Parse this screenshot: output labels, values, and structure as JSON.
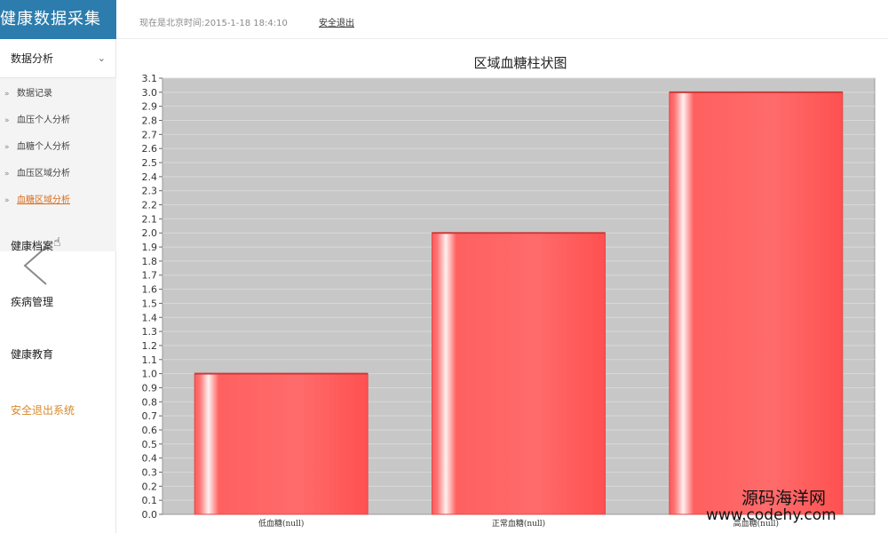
{
  "brand": {
    "title": "健康数据采集"
  },
  "topbar": {
    "time_text": "现在是北京时间:2015-1-18 18:4:10",
    "logout_label": "安全退出"
  },
  "sidebar": {
    "analysis_label": "数据分析",
    "sub_items": [
      {
        "label": "数据记录"
      },
      {
        "label": "血压个人分析"
      },
      {
        "label": "血糖个人分析"
      },
      {
        "label": "血压区域分析"
      },
      {
        "label": "血糖区域分析"
      }
    ],
    "archive_label": "健康档案",
    "disease_label": "疾病管理",
    "education_label": "健康教育",
    "logout_system_label": "安全退出系统"
  },
  "watermark": {
    "line1": "源码海洋网",
    "line2": "www.codehy.com"
  },
  "chart_data": {
    "type": "bar",
    "title": "区域血糖柱状图",
    "categories": [
      "低血糖(null)",
      "正常血糖(null)",
      "高血糖(null)"
    ],
    "values": [
      1.0,
      2.0,
      3.0
    ],
    "ylim": [
      0,
      3.1
    ],
    "ytick_step": 0.1,
    "grid": true,
    "colors": {
      "bar": "#ff5a5a",
      "bar_highlight": "#fff0f0",
      "plot_bg": "#c7c7c7",
      "grid": "#d8d8d8"
    }
  }
}
